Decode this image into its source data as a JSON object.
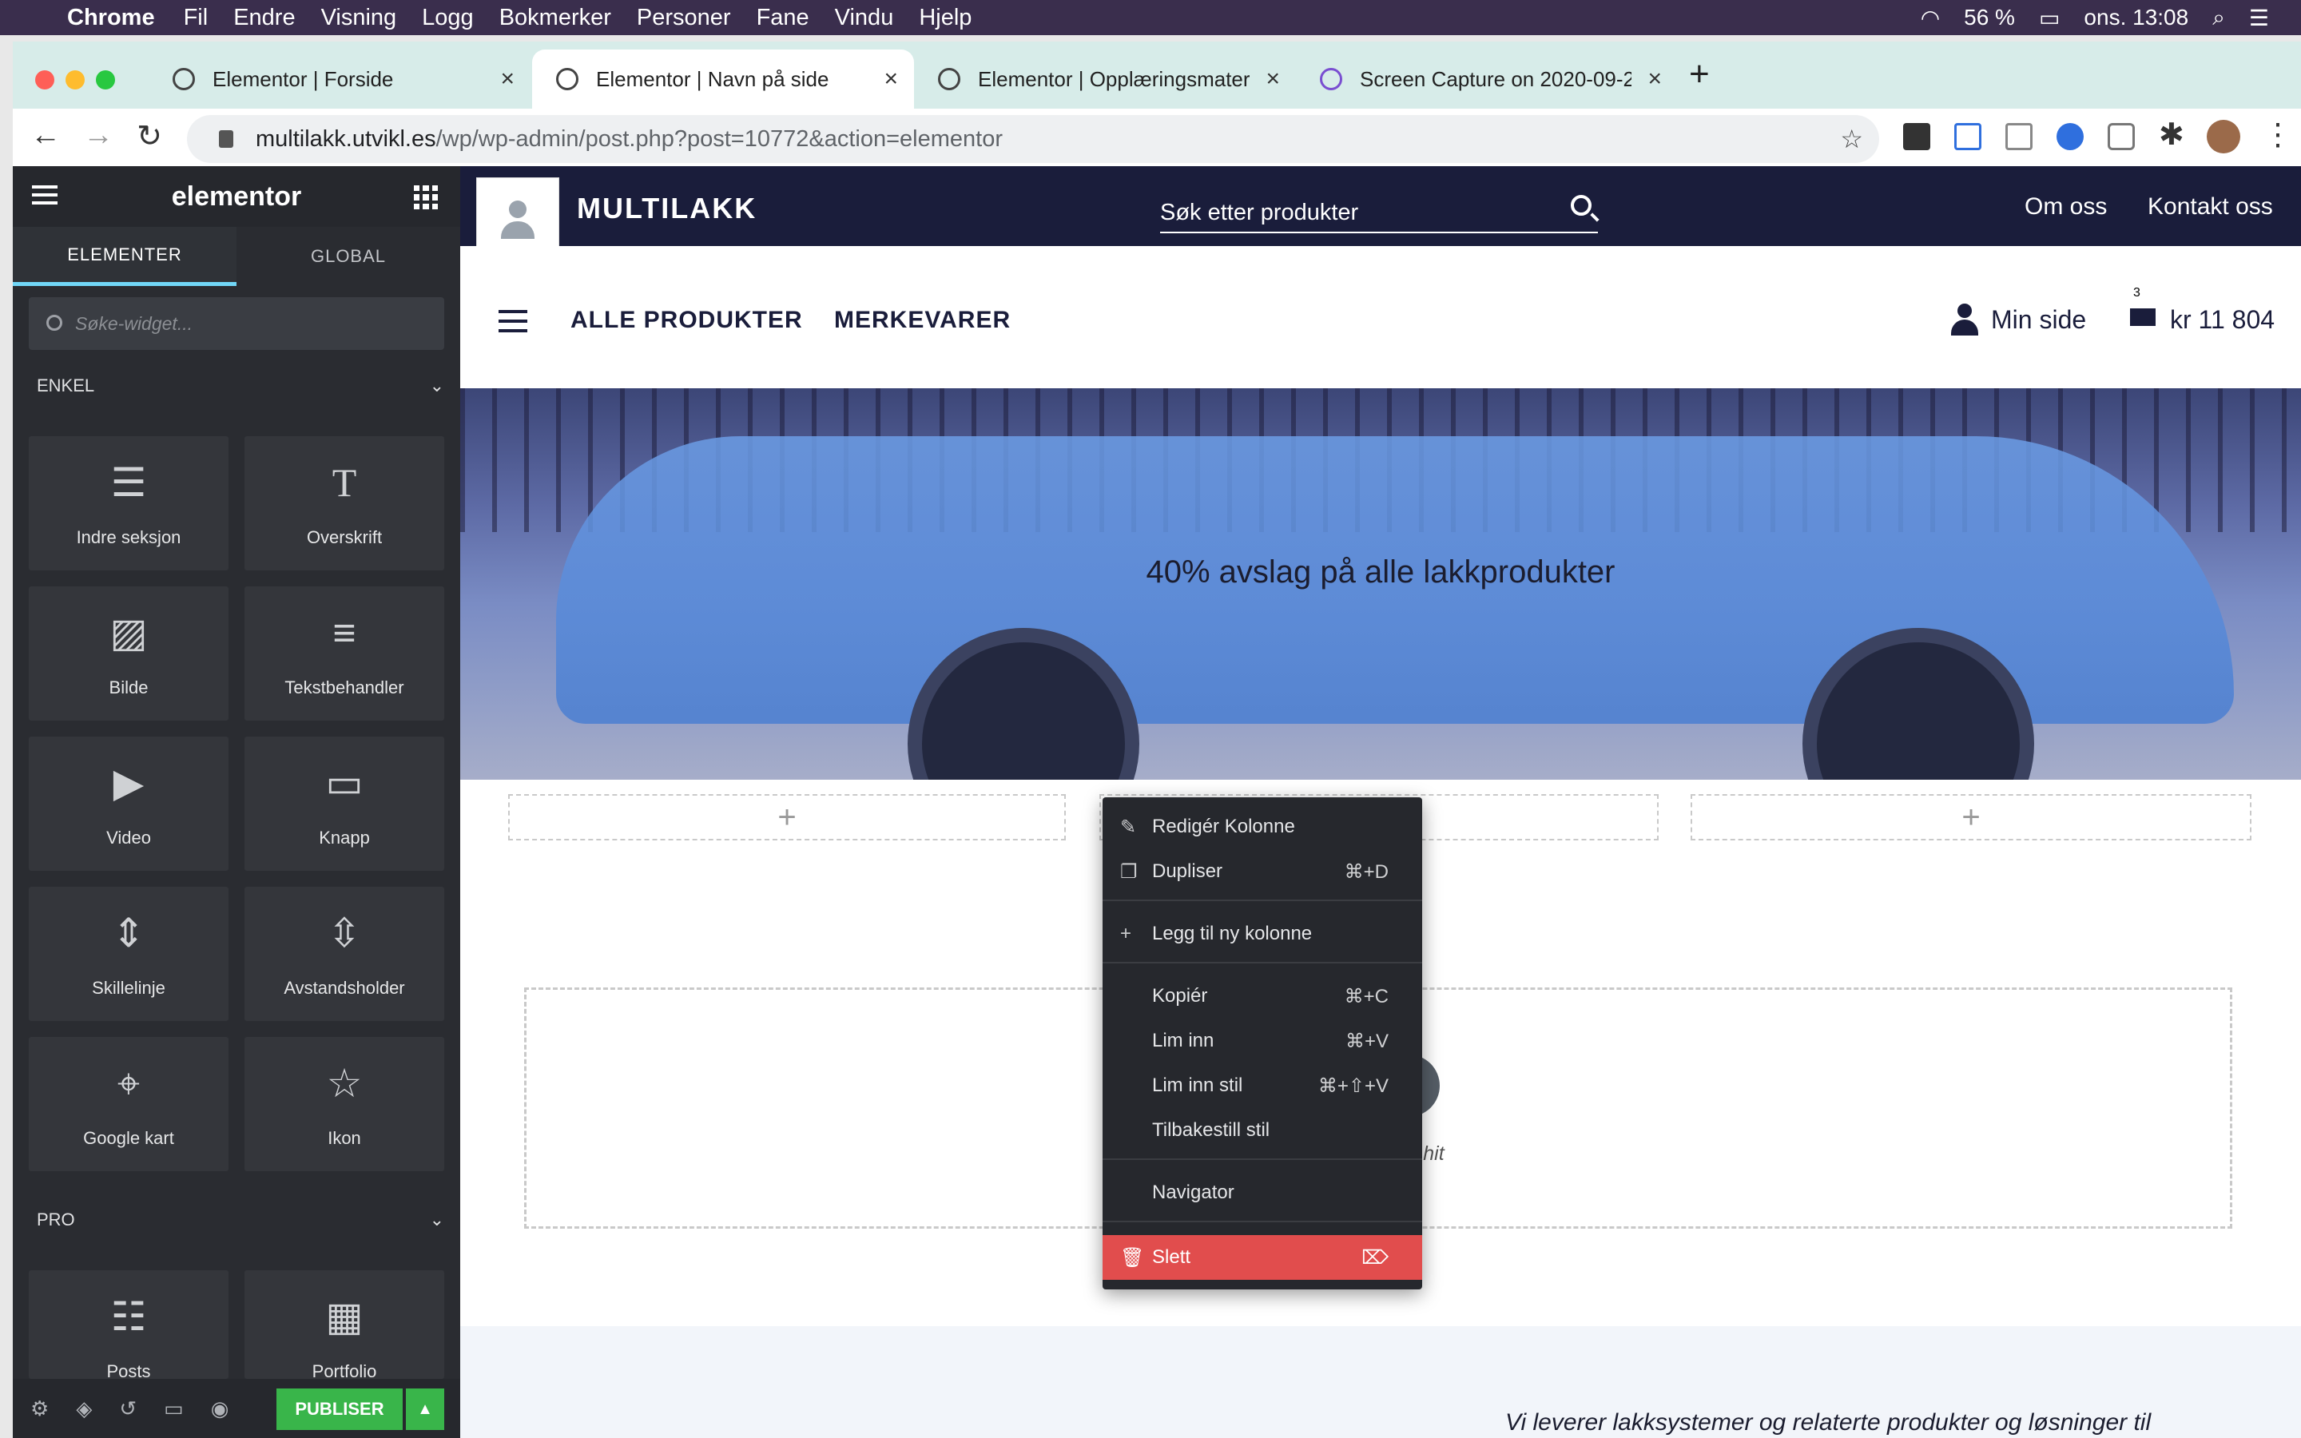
{
  "menubar": {
    "app": "Chrome",
    "items": [
      "Fil",
      "Endre",
      "Visning",
      "Logg",
      "Bokmerker",
      "Personer",
      "Fane",
      "Vindu",
      "Hjelp"
    ],
    "battery": "56 %",
    "clock": "ons. 13:08"
  },
  "tabs": [
    {
      "title": "Elementor | Forside"
    },
    {
      "title": "Elementor | Navn på side"
    },
    {
      "title": "Elementor | Opplæringsmateriell"
    },
    {
      "title": "Screen Capture on 2020-09-2"
    }
  ],
  "address": {
    "host": "multilakk.utvikl.es",
    "path": "/wp/wp-admin/post.php?post=10772&action=elementor"
  },
  "panel": {
    "logo": "elementor",
    "tab_elements": "ELEMENTER",
    "tab_global": "GLOBAL",
    "search_placeholder": "Søke-widget...",
    "section_basic": "ENKEL",
    "section_pro": "PRO",
    "widgets": [
      {
        "label": "Indre seksjon",
        "icon": "inner-section-icon"
      },
      {
        "label": "Overskrift",
        "icon": "heading-icon"
      },
      {
        "label": "Bilde",
        "icon": "image-icon"
      },
      {
        "label": "Tekstbehandler",
        "icon": "text-editor-icon"
      },
      {
        "label": "Video",
        "icon": "video-icon"
      },
      {
        "label": "Knapp",
        "icon": "button-icon"
      },
      {
        "label": "Skillelinje",
        "icon": "divider-icon"
      },
      {
        "label": "Avstandsholder",
        "icon": "spacer-icon"
      },
      {
        "label": "Google kart",
        "icon": "map-icon"
      },
      {
        "label": "Ikon",
        "icon": "star-icon"
      }
    ],
    "pro_widgets": [
      {
        "label": "Posts",
        "icon": "posts-icon"
      },
      {
        "label": "Portfolio",
        "icon": "portfolio-icon"
      }
    ],
    "publish_label": "PUBLISER"
  },
  "site": {
    "brand": "MULTILAKK",
    "search_placeholder": "Søk etter produkter",
    "top_links": [
      "Om oss",
      "Kontakt oss"
    ],
    "nav": [
      "ALLE PRODUKTER",
      "MERKEVARER"
    ],
    "account": "Min side",
    "cart_count": "3",
    "cart_total": "kr 11 804",
    "hero_text": "40% avslag på alle lakkprodukter",
    "drop_hint": "r hit",
    "footer_text": "Vi leverer lakksystemer og relaterte produkter og løsninger til"
  },
  "context_menu": {
    "items": [
      {
        "label": "Redigér Kolonne",
        "shortcut": ""
      },
      {
        "label": "Dupliser",
        "shortcut": "⌘+D"
      },
      {
        "label": "Legg til ny kolonne",
        "shortcut": ""
      },
      {
        "label": "Kopiér",
        "shortcut": "⌘+C"
      },
      {
        "label": "Lim inn",
        "shortcut": "⌘+V"
      },
      {
        "label": "Lim inn stil",
        "shortcut": "⌘+⇧+V"
      },
      {
        "label": "Tilbakestill stil",
        "shortcut": ""
      },
      {
        "label": "Navigator",
        "shortcut": ""
      },
      {
        "label": "Slett",
        "shortcut": ""
      }
    ],
    "danger_color": "#e14d4d"
  }
}
